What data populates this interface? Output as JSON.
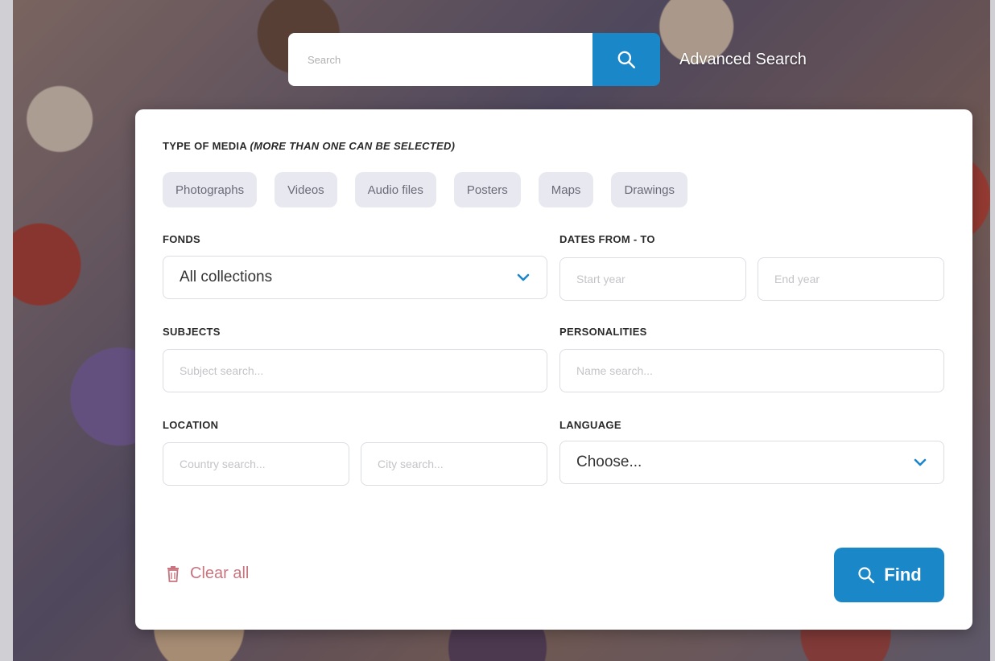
{
  "search": {
    "placeholder": "Search",
    "advanced_label": "Advanced Search"
  },
  "panel": {
    "media_label": "TYPE OF MEDIA ",
    "media_hint": "(MORE THAN ONE CAN BE SELECTED)",
    "media_types": [
      "Photographs",
      "Videos",
      "Audio files",
      "Posters",
      "Maps",
      "Drawings"
    ],
    "fonds_label": "FONDS",
    "fonds_value": "All collections",
    "dates_label": "DATES FROM - TO",
    "start_placeholder": "Start year",
    "end_placeholder": "End year",
    "subjects_label": "SUBJECTS",
    "subjects_placeholder": "Subject search...",
    "personalities_label": "PERSONALITIES",
    "personalities_placeholder": "Name search...",
    "location_label": "LOCATION",
    "country_placeholder": "Country search...",
    "city_placeholder": "City search...",
    "language_label": "LANGUAGE",
    "language_value": "Choose...",
    "clear_label": "Clear all",
    "find_label": "Find"
  },
  "colors": {
    "accent": "#1a87c9",
    "clear": "#c9747e",
    "chip_bg": "#e8e9f0"
  }
}
